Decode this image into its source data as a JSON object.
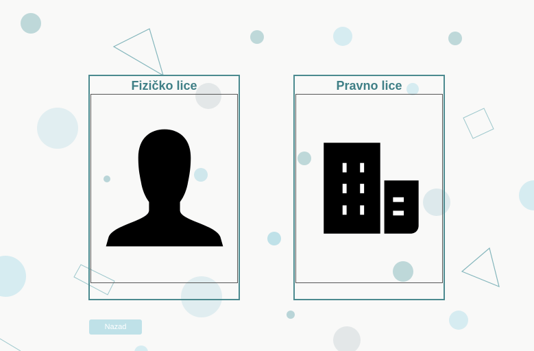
{
  "cards": {
    "natural_person": {
      "title": "Fizičko lice",
      "icon": "person-silhouette-icon"
    },
    "legal_entity": {
      "title": "Pravno lice",
      "icon": "office-building-icon"
    }
  },
  "back_button": {
    "label": "Nazad"
  },
  "colors": {
    "accent": "#4b8a8f",
    "title_text": "#3f7f86",
    "button_bg": "#bfe1e8",
    "page_bg": "#f9f9f8"
  }
}
